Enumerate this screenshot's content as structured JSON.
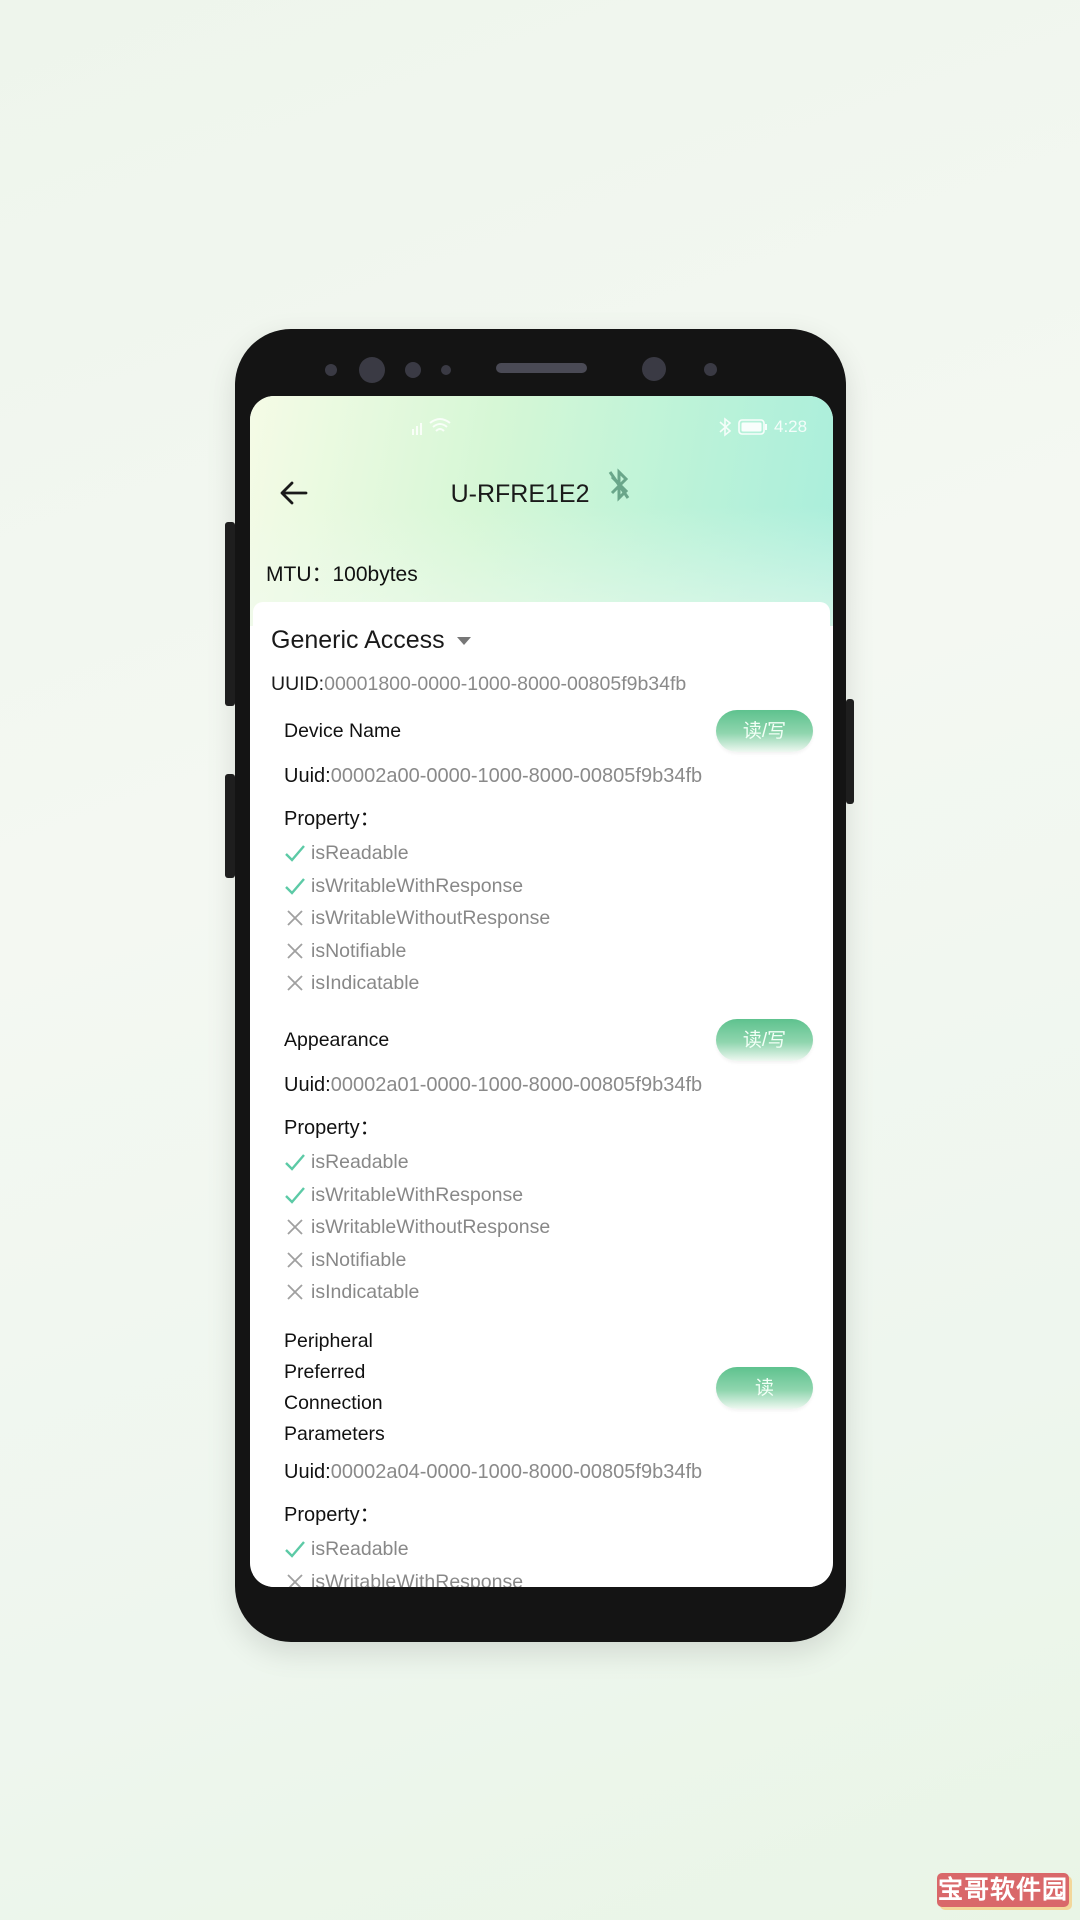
{
  "status_bar": {
    "time": "4:28",
    "icons": [
      "signal-icon",
      "wifi-icon",
      "bluetooth-icon",
      "battery-icon"
    ]
  },
  "header": {
    "title": "U-RFRE1E2",
    "back_icon": "arrow-left-icon",
    "status_icon": "bluetooth-disabled-icon",
    "mtu_label": "MTU：",
    "mtu_value": "100bytes"
  },
  "colors": {
    "accent": "#5ec28e",
    "check": "#5ccaa6",
    "cross": "#a0a0a0"
  },
  "service": {
    "name": "Generic Access",
    "uuid_label": "UUID:",
    "uuid": "00001800-0000-1000-8000-00805f9b34fb",
    "characteristics": [
      {
        "name": "Device Name",
        "button": "读/写",
        "uuid_label": "Uuid:",
        "uuid": "00002a00-0000-1000-8000-00805f9b34fb",
        "property_label": "Property：",
        "properties": [
          {
            "label": "isReadable",
            "enabled": true
          },
          {
            "label": "isWritableWithResponse",
            "enabled": true
          },
          {
            "label": "isWritableWithoutResponse",
            "enabled": false
          },
          {
            "label": "isNotifiable",
            "enabled": false
          },
          {
            "label": "isIndicatable",
            "enabled": false
          }
        ]
      },
      {
        "name": "Appearance",
        "button": "读/写",
        "uuid_label": "Uuid:",
        "uuid": "00002a01-0000-1000-8000-00805f9b34fb",
        "property_label": "Property：",
        "properties": [
          {
            "label": "isReadable",
            "enabled": true
          },
          {
            "label": "isWritableWithResponse",
            "enabled": true
          },
          {
            "label": "isWritableWithoutResponse",
            "enabled": false
          },
          {
            "label": "isNotifiable",
            "enabled": false
          },
          {
            "label": "isIndicatable",
            "enabled": false
          }
        ]
      },
      {
        "name": "Peripheral Preferred Connection Parameters",
        "button": "读",
        "uuid_label": "Uuid:",
        "uuid": "00002a04-0000-1000-8000-00805f9b34fb",
        "property_label": "Property：",
        "properties": [
          {
            "label": "isReadable",
            "enabled": true
          },
          {
            "label": "isWritableWithResponse",
            "enabled": false
          }
        ]
      }
    ]
  },
  "watermark": "宝哥软件园"
}
